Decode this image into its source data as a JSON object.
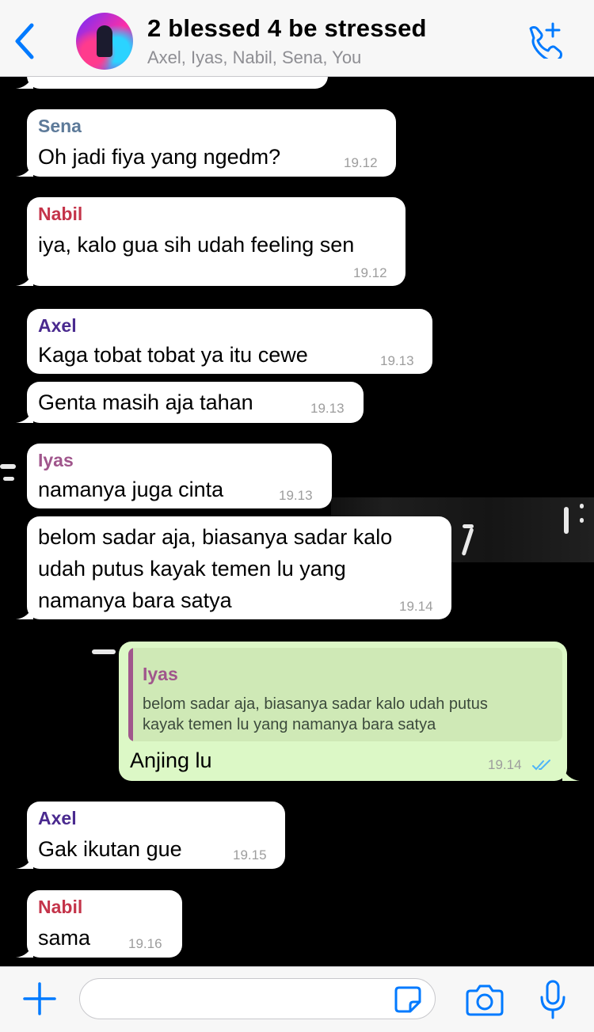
{
  "colors": {
    "accent": "#007aff",
    "incoming_bubble": "#ffffff",
    "outgoing_bubble": "#dcf8c6",
    "sender_sena": "#5d7a99",
    "sender_nabil": "#c4344a",
    "sender_axel": "#4a2a8f",
    "sender_iyas": "#a0568c",
    "read_ticks": "#4fb4f7"
  },
  "header": {
    "back_icon": "chevron-left-icon",
    "title": "2 blessed 4 be stressed",
    "subtitle": "Axel, Iyas, Nabil, Sena, You",
    "call_icon": "add-call-icon"
  },
  "messages": [
    {
      "sender": "Sena",
      "text": "Oh jadi fiya yang ngedm?",
      "time": "19.12",
      "direction": "in"
    },
    {
      "sender": "Nabil",
      "text": "iya, kalo gua sih udah feeling sen",
      "time": "19.12",
      "direction": "in"
    },
    {
      "sender": "Axel",
      "text": "Kaga tobat tobat ya itu cewe",
      "time": "19.13",
      "direction": "in"
    },
    {
      "sender": "",
      "text": "Genta masih aja tahan",
      "time": "19.13",
      "direction": "in"
    },
    {
      "sender": "Iyas",
      "text": "namanya juga cinta",
      "time": "19.13",
      "direction": "in"
    },
    {
      "sender": "",
      "lines": [
        "belom sadar aja, biasanya sadar kalo",
        "udah putus kayak temen lu yang",
        "namanya bara satya"
      ],
      "time": "19.14",
      "direction": "in"
    },
    {
      "sender": "You",
      "quote": {
        "sender": "Iyas",
        "lines": [
          "belom sadar aja, biasanya sadar kalo udah putus",
          "kayak temen lu yang namanya bara satya"
        ]
      },
      "text": "Anjing lu",
      "time": "19.14",
      "status": "read",
      "direction": "out"
    },
    {
      "sender": "Axel",
      "text": "Gak ikutan gue",
      "time": "19.15",
      "direction": "in"
    },
    {
      "sender": "Nabil",
      "text": "sama",
      "time": "19.16",
      "direction": "in"
    }
  ],
  "input_bar": {
    "plus_icon": "plus-icon",
    "placeholder": "",
    "sticker_icon": "sticker-icon",
    "camera_icon": "camera-icon",
    "mic_icon": "microphone-icon"
  }
}
